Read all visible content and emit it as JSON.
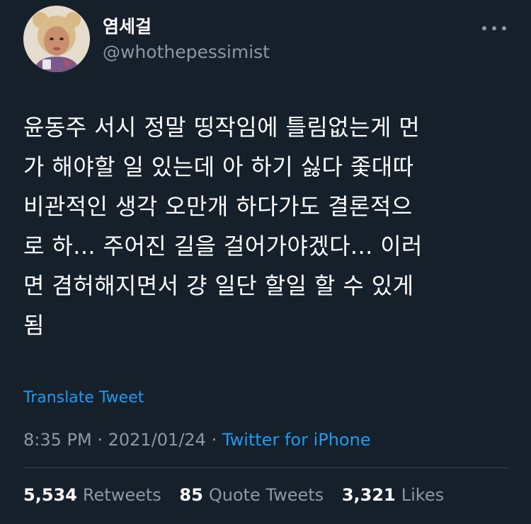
{
  "theme": {
    "background": "#15202b",
    "text_primary": "#ffffff",
    "text_secondary": "#8b98a5",
    "accent": "#1d9bf0",
    "divider": "#38444d"
  },
  "tweet": {
    "author": {
      "display_name": "염세걸",
      "handle": "@whothepessimist",
      "avatar_icon": "profile-photo"
    },
    "more_icon": "more-horizontal-icon",
    "text": "윤동주 서시 정말 띵작임에 틀림없는게 먼\n가 해야할 일 있는데 아 하기 싫다 좇대따\n비관적인 생각 오만개 하다가도 결론적으\n로 하... 주어진 길을 걸어가야겠다... 이러\n면 겸허해지면서 걍 일단 할일 할 수 있게\n됨",
    "translate_label": "Translate Tweet",
    "time": "8:35 PM",
    "date": "2021/01/24",
    "separator": "·",
    "source": "Twitter for iPhone",
    "stats": {
      "retweets": {
        "count": "5,534",
        "label": "Retweets"
      },
      "quote_tweets": {
        "count": "85",
        "label": "Quote Tweets"
      },
      "likes": {
        "count": "3,321",
        "label": "Likes"
      }
    }
  }
}
